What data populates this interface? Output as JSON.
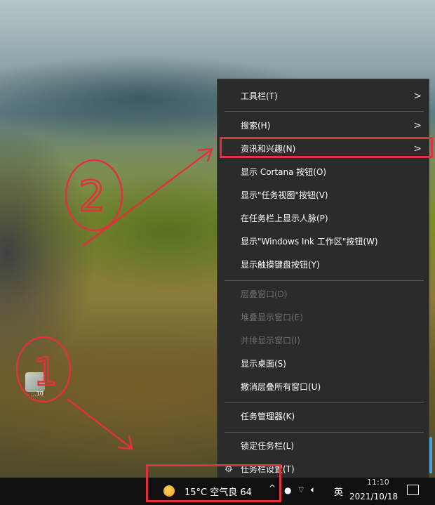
{
  "desktop": {
    "icon_label": "...10"
  },
  "context_menu": {
    "items": [
      {
        "label": "工具栏(T)",
        "has_submenu": true,
        "disabled": false
      },
      {
        "label": "搜索(H)",
        "has_submenu": true,
        "disabled": false
      },
      {
        "label": "资讯和兴趣(N)",
        "has_submenu": true,
        "disabled": false,
        "highlighted": true
      },
      {
        "label": "显示 Cortana 按钮(O)",
        "disabled": false
      },
      {
        "label": "显示\"任务视图\"按钮(V)",
        "disabled": false
      },
      {
        "label": "在任务栏上显示人脉(P)",
        "disabled": false
      },
      {
        "label": "显示\"Windows Ink 工作区\"按钮(W)",
        "disabled": false
      },
      {
        "label": "显示触摸键盘按钮(Y)",
        "disabled": false
      },
      {
        "label": "层叠窗口(D)",
        "disabled": true
      },
      {
        "label": "堆叠显示窗口(E)",
        "disabled": true
      },
      {
        "label": "并排显示窗口(I)",
        "disabled": true
      },
      {
        "label": "显示桌面(S)",
        "disabled": false
      },
      {
        "label": "撤消层叠所有窗口(U)",
        "disabled": false
      },
      {
        "label": "任务管理器(K)",
        "disabled": false
      },
      {
        "label": "锁定任务栏(L)",
        "disabled": false
      },
      {
        "label": "任务栏设置(T)",
        "disabled": false,
        "icon": "gear-icon"
      }
    ],
    "submenu_arrow": ">"
  },
  "taskbar": {
    "weather_text": "15°C 空气良 64",
    "caret": "^",
    "ime": "英",
    "time": "11:10",
    "date": "2021/10/18"
  },
  "annotations": {
    "step1": "1",
    "step2": "2",
    "color": "#e0323c"
  }
}
